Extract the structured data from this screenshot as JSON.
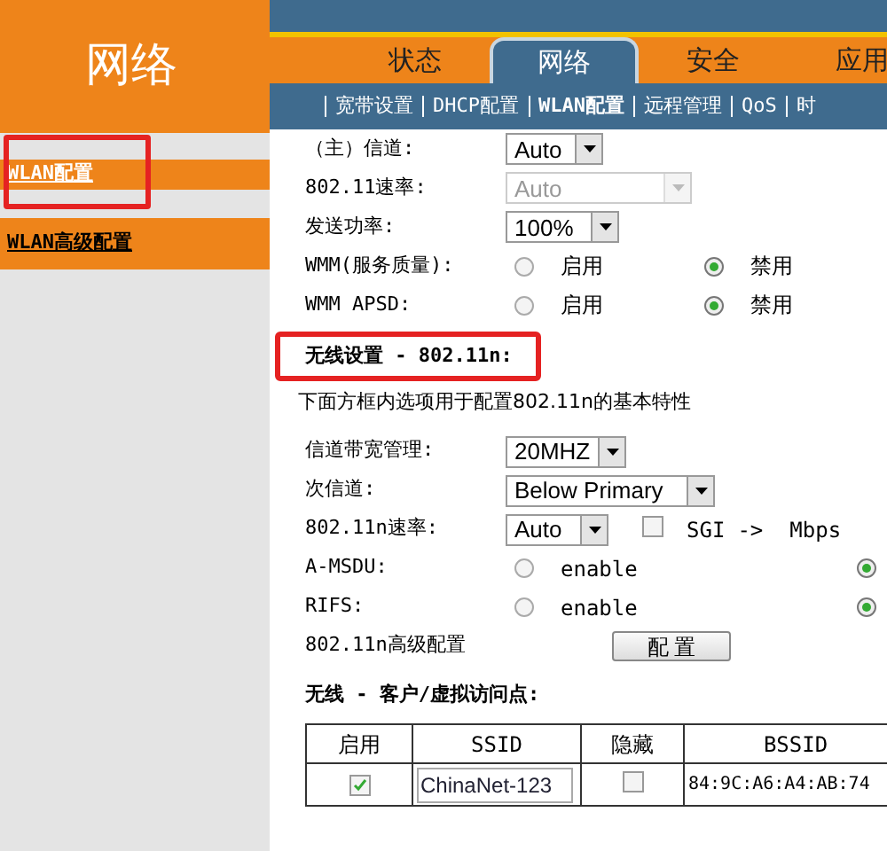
{
  "sidebar": {
    "title": "网络",
    "items": [
      {
        "label": "WLAN配置",
        "selected": true
      },
      {
        "label": "WLAN高级配置",
        "selected": false
      }
    ]
  },
  "tabs": [
    {
      "label": "状态",
      "selected": false
    },
    {
      "label": "网络",
      "selected": true
    },
    {
      "label": "安全",
      "selected": false
    },
    {
      "label": "应用",
      "selected": false
    }
  ],
  "subnav": [
    {
      "label": "宽带设置",
      "selected": false
    },
    {
      "label": "DHCP配置",
      "selected": false
    },
    {
      "label": "WLAN配置",
      "selected": true
    },
    {
      "label": "远程管理",
      "selected": false
    },
    {
      "label": "QoS",
      "selected": false
    },
    {
      "label": "时",
      "selected": false
    }
  ],
  "basic_rows": [
    {
      "kind": "select",
      "label": "（主）信道:",
      "value": "Auto",
      "disabled": false
    },
    {
      "kind": "select",
      "label": "802.11速率:",
      "value": "Auto",
      "disabled": true
    },
    {
      "kind": "select",
      "label": "发送功率:",
      "value": "100%",
      "disabled": false
    },
    {
      "kind": "radio",
      "label": "WMM(服务质量):",
      "options": [
        {
          "label": "启用",
          "selected": false
        },
        {
          "label": "禁用",
          "selected": true
        }
      ]
    },
    {
      "kind": "radio",
      "label": "WMM APSD:",
      "options": [
        {
          "label": "启用",
          "selected": false
        },
        {
          "label": "禁用",
          "selected": true
        }
      ]
    }
  ],
  "n_section": {
    "heading": "无线设置 - 802.11n:",
    "description": "下面方框内选项用于配置802.11n的基本特性",
    "rows": [
      {
        "kind": "select",
        "label": "信道带宽管理:",
        "value": "20MHZ",
        "disabled": false
      },
      {
        "kind": "select",
        "label": "次信道:",
        "value": "Below Primary",
        "disabled": false
      },
      {
        "kind": "rate",
        "label": "802.11n速率:",
        "value": "Auto",
        "disabled": false,
        "checked": false,
        "sgi": "SGI",
        "arrow": "->",
        "unit": "Mbps"
      },
      {
        "kind": "radio",
        "label": "A-MSDU:",
        "options": [
          {
            "label": "enable",
            "selected": false
          },
          {
            "selected": true
          }
        ]
      },
      {
        "kind": "radio",
        "label": "RIFS:",
        "options": [
          {
            "label": "enable",
            "selected": false
          },
          {
            "selected": true
          }
        ]
      },
      {
        "kind": "button",
        "label": "802.11n高级配置",
        "button": "配 置"
      }
    ]
  },
  "ap_section": {
    "heading": "无线 - 客户/虚拟访问点:",
    "columns": [
      "启用",
      "SSID",
      "隐藏",
      "BSSID"
    ],
    "rows": [
      {
        "enabled": true,
        "ssid": "ChinaNet-123",
        "hidden": false,
        "bssid": "84:9C:A6:A4:AB:74"
      }
    ]
  }
}
